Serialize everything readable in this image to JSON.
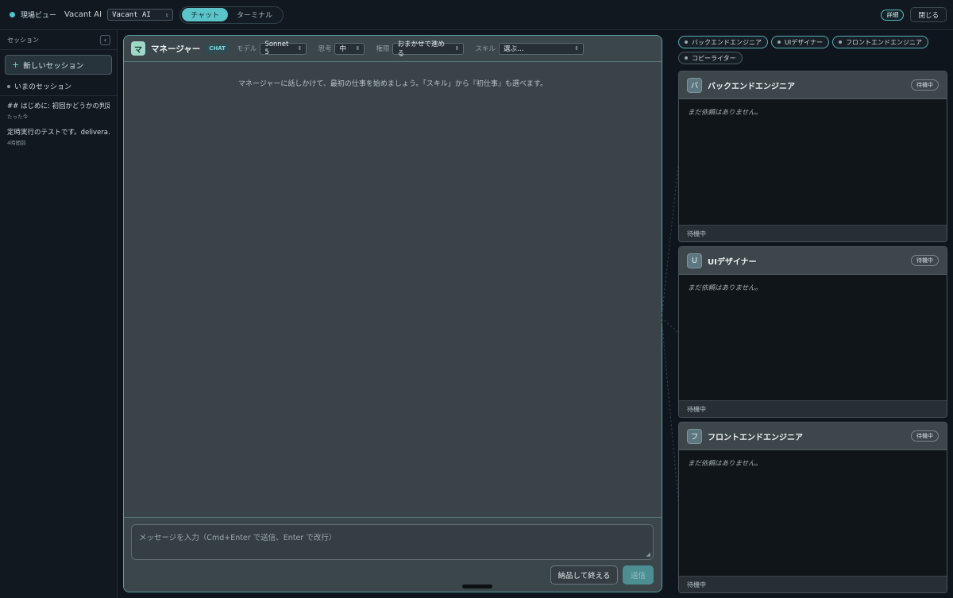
{
  "topbar": {
    "live_label": "現場ビュー",
    "app_name": "Vacant AI",
    "workspace_select": "Vacant AI",
    "modes": [
      {
        "label": "チャット",
        "active": true
      },
      {
        "label": "ターミナル",
        "active": false
      }
    ],
    "details_label": "詳細",
    "close_label": "閉じる"
  },
  "sidebar": {
    "header": "セッション",
    "collapse_glyph": "‹",
    "new_session_label": "新しいセッション",
    "current_session_label": "いまのセッション",
    "sessions": [
      {
        "title": "## はじめに: 初回かどうかの判定 …",
        "time": "たった今"
      },
      {
        "title": "定時実行のテストです。delivera…",
        "time": "4時間前"
      }
    ]
  },
  "manager": {
    "avatar": "マ",
    "name": "マネージャー",
    "badge": "CHAT",
    "model_label": "モデル",
    "model_value": "Sonnet 5",
    "thinking_label": "思考",
    "thinking_value": "中",
    "permission_label": "権限",
    "permission_value": "おまかせで進める",
    "skill_label": "スキル",
    "skill_value": "選ぶ…",
    "empty_hint": "マネージャーに話しかけて、最初の仕事を始めましょう。「スキル」から『初仕事』も選べます。",
    "input_placeholder": "メッセージを入力（Cmd+Enter で送信、Enter で改行）",
    "deliver_label": "納品して終える",
    "send_label": "送信"
  },
  "roles": [
    {
      "label": "バックエンドエンジニア"
    },
    {
      "label": "UIデザイナー"
    },
    {
      "label": "フロントエンドエンジニア"
    },
    {
      "label": "コピーライター"
    }
  ],
  "agents": [
    {
      "avatar": "バ",
      "name": "バックエンドエンジニア",
      "badge": "待機中",
      "empty": "まだ依頼はありません。",
      "status": "待機中"
    },
    {
      "avatar": "U",
      "name": "UIデザイナー",
      "badge": "待機中",
      "empty": "まだ依頼はありません。",
      "status": "待機中"
    },
    {
      "avatar": "フ",
      "name": "フロントエンドエンジニア",
      "badge": "待機中",
      "empty": "まだ依頼はありません。",
      "status": "待機中"
    }
  ],
  "colors": {
    "accent": "#5ac4c9",
    "background": "#0f151c",
    "panel": "#3a4448"
  }
}
